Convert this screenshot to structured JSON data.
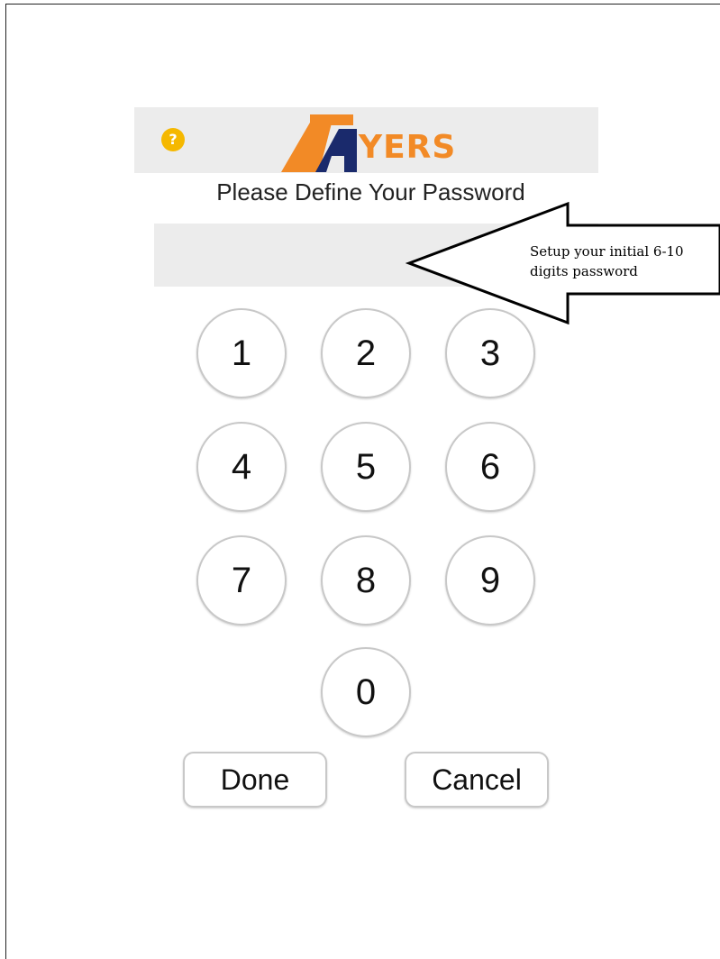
{
  "header": {
    "help_icon_glyph": "?",
    "logo_text": "YERS",
    "logo_colors": {
      "orange": "#f28a26",
      "navy": "#1a2a6c"
    }
  },
  "title": "Please Define Your Password",
  "password_field": {
    "value": "",
    "placeholder": ""
  },
  "callout": {
    "text": "Setup your initial 6-10\ndigits password"
  },
  "keypad": {
    "keys": [
      "1",
      "2",
      "3",
      "4",
      "5",
      "6",
      "7",
      "8",
      "9",
      "0"
    ]
  },
  "buttons": {
    "done": "Done",
    "cancel": "Cancel"
  },
  "colors": {
    "header_bg": "#ececec",
    "help_icon": "#f5b800"
  }
}
